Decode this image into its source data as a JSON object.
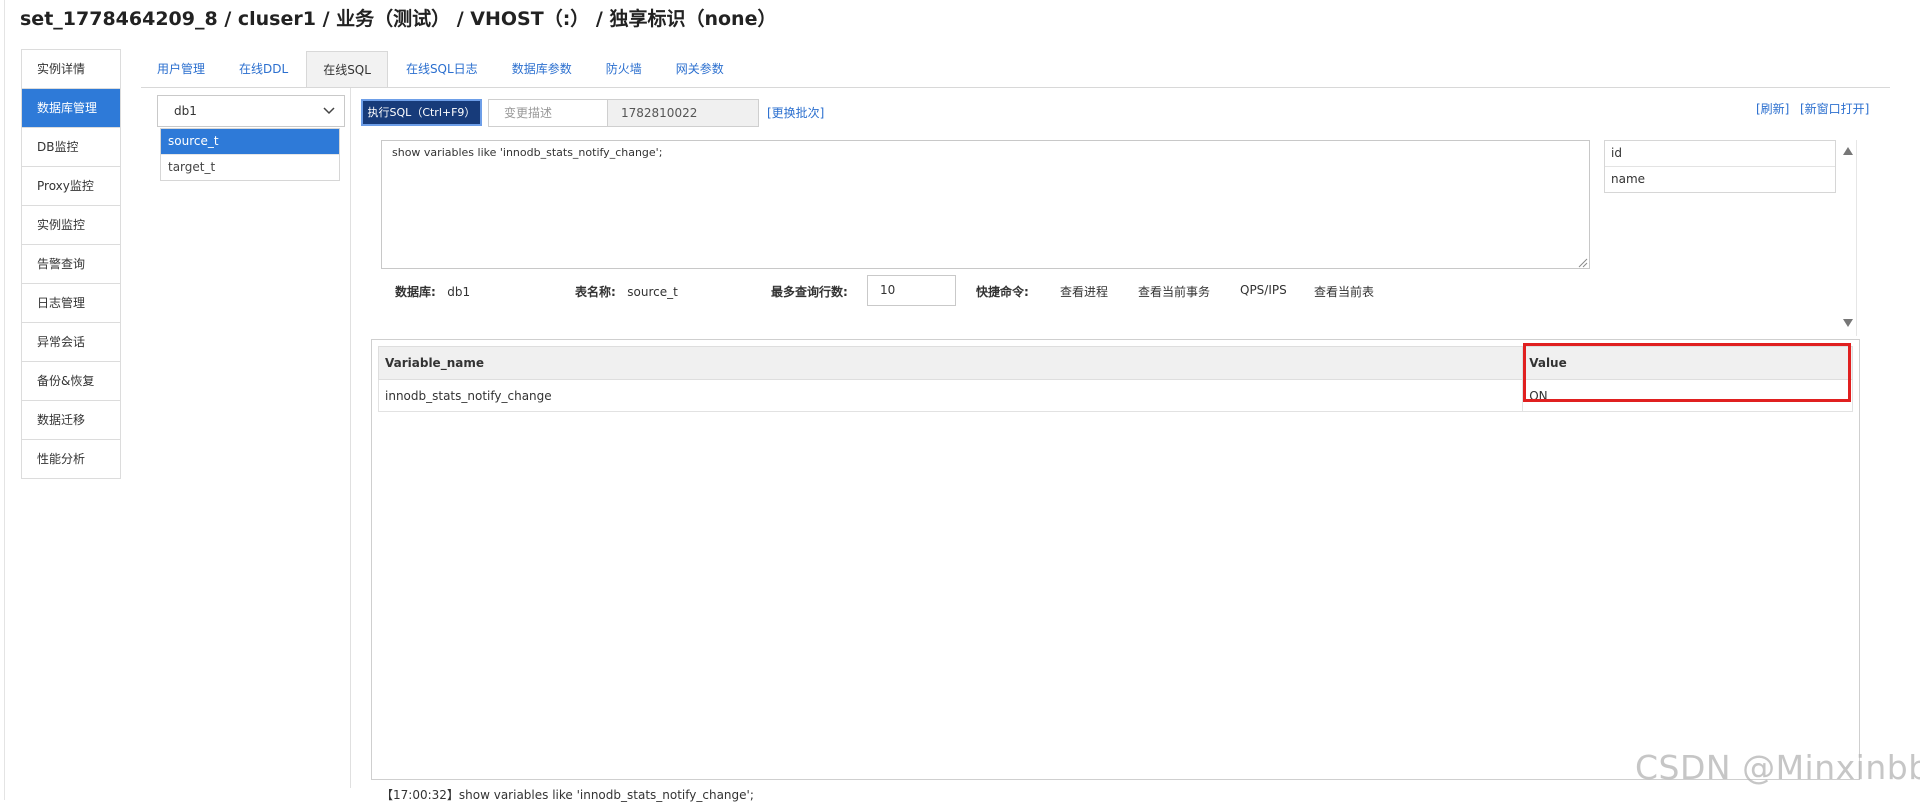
{
  "header": {
    "title": "set_1778464209_8 / cluser1 / 业务（测试） / VHOST（:） / 独享标识（none）"
  },
  "sidebar": {
    "items": [
      {
        "label": "实例详情",
        "active": false
      },
      {
        "label": "数据库管理",
        "active": true
      },
      {
        "label": "DB监控",
        "active": false
      },
      {
        "label": "Proxy监控",
        "active": false
      },
      {
        "label": "实例监控",
        "active": false
      },
      {
        "label": "告警查询",
        "active": false
      },
      {
        "label": "日志管理",
        "active": false
      },
      {
        "label": "异常会话",
        "active": false
      },
      {
        "label": "备份&恢复",
        "active": false
      },
      {
        "label": "数据迁移",
        "active": false
      },
      {
        "label": "性能分析",
        "active": false
      }
    ]
  },
  "tabs": [
    {
      "label": "用户管理",
      "active": false
    },
    {
      "label": "在线DDL",
      "active": false
    },
    {
      "label": "在线SQL",
      "active": true
    },
    {
      "label": "在线SQL日志",
      "active": false
    },
    {
      "label": "数据库参数",
      "active": false
    },
    {
      "label": "防火墙",
      "active": false
    },
    {
      "label": "网关参数",
      "active": false
    }
  ],
  "db_panel": {
    "selected_db": "db1",
    "tables": [
      {
        "name": "source_t",
        "active": true
      },
      {
        "name": "target_t",
        "active": false
      }
    ]
  },
  "toolbar": {
    "exec_label": "执行SQL（Ctrl+F9）",
    "change_desc_placeholder": "变更描述",
    "task_id": "1782810022",
    "switch_batch": "[更换批次]",
    "refresh": "[刷新]",
    "new_window": "[新窗口打开]"
  },
  "editor": {
    "sql": "show variables like 'innodb_stats_notify_change';"
  },
  "columns": [
    "id",
    "name"
  ],
  "info": {
    "db_label": "数据库:",
    "db_value": "db1",
    "table_label": "表名称:",
    "table_value": "source_t",
    "max_rows_label": "最多查询行数:",
    "max_rows_value": "10",
    "shortcut_label": "快捷命令:",
    "shortcuts": [
      "查看进程",
      "查看当前事务",
      "QPS/IPS",
      "查看当前表"
    ]
  },
  "results": {
    "headers": [
      "Variable_name",
      "Value"
    ],
    "rows": [
      [
        "innodb_stats_notify_change",
        "ON"
      ]
    ]
  },
  "log": "【17:00:32】show variables like 'innodb_stats_notify_change';",
  "watermark": "CSDN @Minxinbb",
  "colors": {
    "accent": "#2e7ad8",
    "exec_button": "#173b7a",
    "highlight": "#e02020",
    "link": "#2b6fcf"
  }
}
